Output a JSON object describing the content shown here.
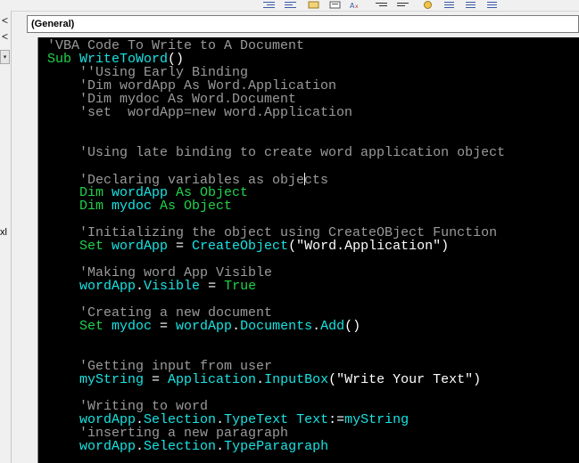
{
  "toolbar": {
    "icons": [
      "indent-icon",
      "outdent-icon",
      "toggle-breakpoint-icon",
      "comment-block-icon",
      "uncomment-block-icon",
      "list-properties-icon",
      "list-constants-icon",
      "quick-info-icon",
      "toggle-bookmark-icon",
      "next-bookmark-icon",
      "previous-bookmark-icon"
    ]
  },
  "left_strip": {
    "up_arrow": "<",
    "down_arrow": "<",
    "text": "xl"
  },
  "object_combo": {
    "value": "(General)"
  },
  "code": {
    "lines": [
      [
        {
          "t": "'VBA Code To Write to A Document",
          "k": "c"
        }
      ],
      [
        {
          "t": "Sub ",
          "k": "kw"
        },
        {
          "t": "WriteToWord",
          "k": "id"
        },
        {
          "t": "()",
          "k": "op"
        }
      ],
      [
        {
          "t": "    ''Using Early Binding",
          "k": "c"
        }
      ],
      [
        {
          "t": "    'Dim wordApp As Word.Application",
          "k": "c"
        }
      ],
      [
        {
          "t": "    'Dim mydoc As Word.Document",
          "k": "c"
        }
      ],
      [
        {
          "t": "    'set  wordApp=new word.Application",
          "k": "c"
        }
      ],
      [],
      [],
      [
        {
          "t": "    'Using late binding to create word application object",
          "k": "c"
        }
      ],
      [],
      [
        {
          "t": "    'Declaring variables as obje",
          "k": "c"
        },
        {
          "caret": true
        },
        {
          "t": "cts",
          "k": "c"
        }
      ],
      [
        {
          "t": "    Dim ",
          "k": "kw"
        },
        {
          "t": "wordApp ",
          "k": "id"
        },
        {
          "t": "As ",
          "k": "kw"
        },
        {
          "t": "Object",
          "k": "kw"
        }
      ],
      [
        {
          "t": "    Dim ",
          "k": "kw"
        },
        {
          "t": "mydoc ",
          "k": "id"
        },
        {
          "t": "As ",
          "k": "kw"
        },
        {
          "t": "Object",
          "k": "kw"
        }
      ],
      [],
      [
        {
          "t": "    'Initializing the object using CreateOBject Function",
          "k": "c"
        }
      ],
      [
        {
          "t": "    Set ",
          "k": "kw"
        },
        {
          "t": "wordApp ",
          "k": "id"
        },
        {
          "t": "= ",
          "k": "op"
        },
        {
          "t": "CreateObject",
          "k": "id"
        },
        {
          "t": "(\"Word.Application\")",
          "k": "str"
        }
      ],
      [],
      [
        {
          "t": "    'Making word App Visible",
          "k": "c"
        }
      ],
      [
        {
          "t": "    wordApp",
          "k": "id"
        },
        {
          "t": ".",
          "k": "op"
        },
        {
          "t": "Visible ",
          "k": "id"
        },
        {
          "t": "= ",
          "k": "op"
        },
        {
          "t": "True",
          "k": "kw"
        }
      ],
      [],
      [
        {
          "t": "    'Creating a new document",
          "k": "c"
        }
      ],
      [
        {
          "t": "    Set ",
          "k": "kw"
        },
        {
          "t": "mydoc ",
          "k": "id"
        },
        {
          "t": "= ",
          "k": "op"
        },
        {
          "t": "wordApp",
          "k": "id"
        },
        {
          "t": ".",
          "k": "op"
        },
        {
          "t": "Documents",
          "k": "id"
        },
        {
          "t": ".",
          "k": "op"
        },
        {
          "t": "Add",
          "k": "id"
        },
        {
          "t": "()",
          "k": "op"
        }
      ],
      [],
      [],
      [
        {
          "t": "    'Getting input from user",
          "k": "c"
        }
      ],
      [
        {
          "t": "    myString ",
          "k": "id"
        },
        {
          "t": "= ",
          "k": "op"
        },
        {
          "t": "Application",
          "k": "id"
        },
        {
          "t": ".",
          "k": "op"
        },
        {
          "t": "InputBox",
          "k": "id"
        },
        {
          "t": "(\"Write Your Text\")",
          "k": "str"
        }
      ],
      [],
      [
        {
          "t": "    'Writing to word",
          "k": "c"
        }
      ],
      [
        {
          "t": "    wordApp",
          "k": "id"
        },
        {
          "t": ".",
          "k": "op"
        },
        {
          "t": "Selection",
          "k": "id"
        },
        {
          "t": ".",
          "k": "op"
        },
        {
          "t": "TypeText ",
          "k": "id"
        },
        {
          "t": "Text",
          "k": "id"
        },
        {
          "t": ":=",
          "k": "op"
        },
        {
          "t": "myString",
          "k": "id"
        }
      ],
      [
        {
          "t": "    'inserting a new paragraph",
          "k": "c"
        }
      ],
      [
        {
          "t": "    wordApp",
          "k": "id"
        },
        {
          "t": ".",
          "k": "op"
        },
        {
          "t": "Selection",
          "k": "id"
        },
        {
          "t": ".",
          "k": "op"
        },
        {
          "t": "TypeParagraph",
          "k": "id"
        }
      ]
    ]
  },
  "colors": {
    "editor_background": "#000000",
    "comment": "#9a9a9a",
    "keyword": "#1fd34a",
    "identifier": "#19e3e3",
    "plain": "#ffffff"
  }
}
